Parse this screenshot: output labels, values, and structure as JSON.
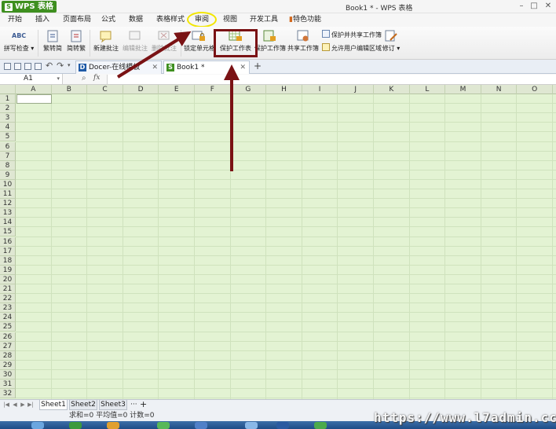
{
  "app": {
    "name": "WPS 表格",
    "logo_letter": "S",
    "document_title": "Book1 * - WPS 表格"
  },
  "menu": {
    "tabs": [
      "开始",
      "插入",
      "页面布局",
      "公式",
      "数据",
      "表格样式",
      "审阅",
      "视图",
      "开发工具",
      "特色功能"
    ],
    "active": "审阅"
  },
  "ribbon": {
    "spell_check": "拼写检查",
    "spell_check_icon": "ABC",
    "to_traditional": "繁转简",
    "to_simplified": "简转繁",
    "new_comment": "新建批注",
    "edit_comment": "编辑批注",
    "delete_comment": "删除批注",
    "lock_cell": "锁定单元格",
    "protect_sheet": "保护工作表",
    "protect_workbook": "保护工作簿",
    "share_workbook": "共享工作簿",
    "protect_and_share": "保护并共享工作簿",
    "allow_edit_ranges": "允许用户编辑区域",
    "track_changes": "修订"
  },
  "document_tabs": [
    {
      "label": "Docer-在线模板",
      "icon": "D"
    },
    {
      "label": "Book1 *",
      "icon": "S"
    }
  ],
  "formula_bar": {
    "cell_ref": "A1",
    "fx": "fx"
  },
  "grid": {
    "columns": [
      "A",
      "B",
      "C",
      "D",
      "E",
      "F",
      "G",
      "H",
      "I",
      "J",
      "K",
      "L",
      "M",
      "N",
      "O"
    ],
    "rows": [
      "1",
      "2",
      "3",
      "4",
      "5",
      "6",
      "7",
      "8",
      "9",
      "10",
      "11",
      "12",
      "13",
      "14",
      "15",
      "16",
      "17",
      "18",
      "19",
      "20",
      "21",
      "22",
      "23",
      "24",
      "25",
      "26",
      "27",
      "28",
      "29",
      "30",
      "31",
      "32"
    ]
  },
  "sheets": {
    "tabs": [
      "Sheet1",
      "Sheet2",
      "Sheet3"
    ],
    "more": "···",
    "add": "+"
  },
  "status": {
    "text": "求和=0  平均值=0  计数=0"
  },
  "watermark": "https://www.l7admin.cc",
  "colors": {
    "accent_green": "#3e8f1f",
    "grid_bg": "#e3f3d3",
    "annotation_red": "#7a1214",
    "annotation_yellow": "#f2e600"
  }
}
